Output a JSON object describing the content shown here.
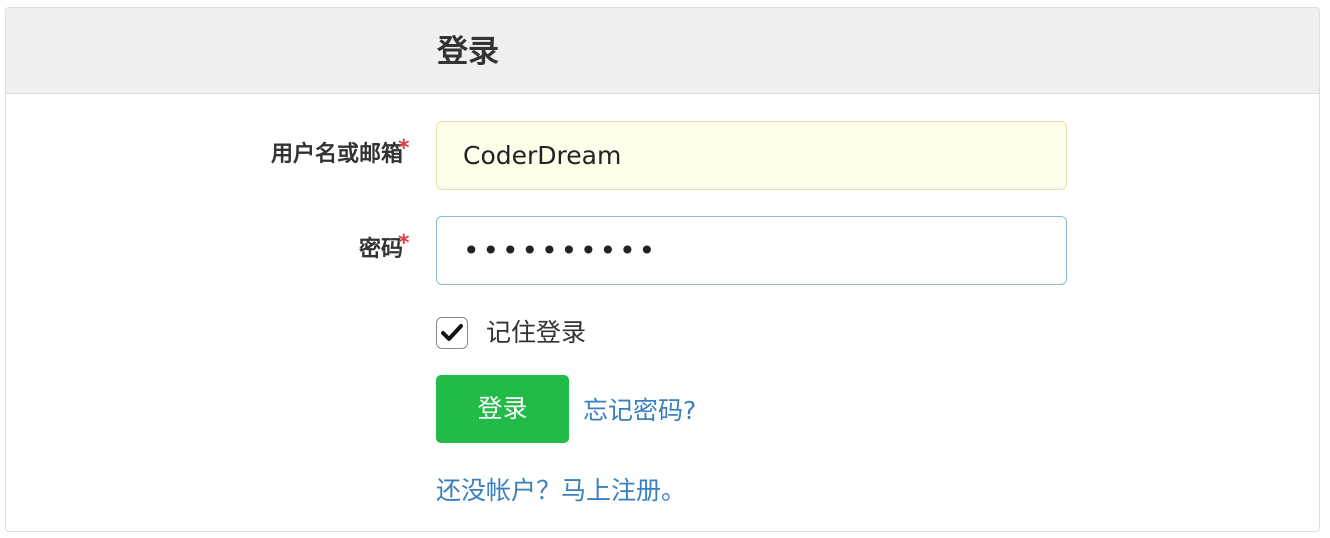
{
  "panel": {
    "title": "登录"
  },
  "form": {
    "username": {
      "label": "用户名或邮箱",
      "required_mark": "*",
      "value": "CoderDream"
    },
    "password": {
      "label": "密码",
      "required_mark": "*",
      "value": "••••••••••"
    },
    "remember": {
      "label": "记住登录",
      "checked": true
    },
    "submit_label": "登录",
    "forgot_link": "忘记密码?",
    "register_link": "还没帐户？马上注册。"
  },
  "colors": {
    "primary_button": "#22bb48",
    "link": "#3a80c0",
    "required": "#e03a3a",
    "heading_bg": "#f0f0f0"
  }
}
